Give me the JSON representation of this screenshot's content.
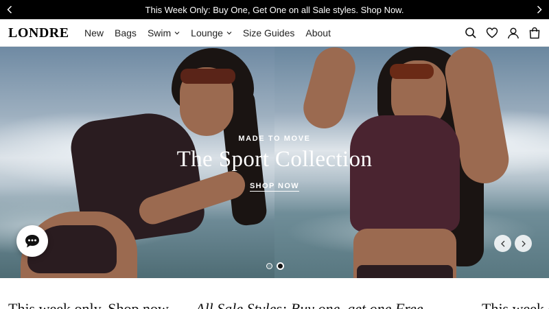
{
  "announcement": {
    "text": "This Week Only: Buy One, Get One on all Sale styles. Shop Now.",
    "prev_icon": "chevron-left-icon",
    "next_icon": "chevron-right-icon"
  },
  "header": {
    "logo": "LONDRE",
    "nav": [
      {
        "label": "New",
        "dropdown": false
      },
      {
        "label": "Bags",
        "dropdown": false
      },
      {
        "label": "Swim",
        "dropdown": true
      },
      {
        "label": "Lounge",
        "dropdown": true
      },
      {
        "label": "Size Guides",
        "dropdown": false
      },
      {
        "label": "About",
        "dropdown": false
      }
    ],
    "icons": [
      "search-icon",
      "heart-icon",
      "account-icon",
      "bag-icon"
    ]
  },
  "hero": {
    "eyebrow": "MADE TO MOVE",
    "headline": "The Sport Collection",
    "cta": "SHOP NOW",
    "slides_total": 2,
    "active_slide": 2
  },
  "chat": {
    "icon": "chat-bubble-icon"
  },
  "marquee": {
    "items": [
      "This week only. Shop now",
      "All Sale Styles: Buy one, get one Free",
      "This week o"
    ]
  },
  "colors": {
    "announcement_bg": "#000000",
    "text": "#111111",
    "hero_text": "#ffffff"
  }
}
